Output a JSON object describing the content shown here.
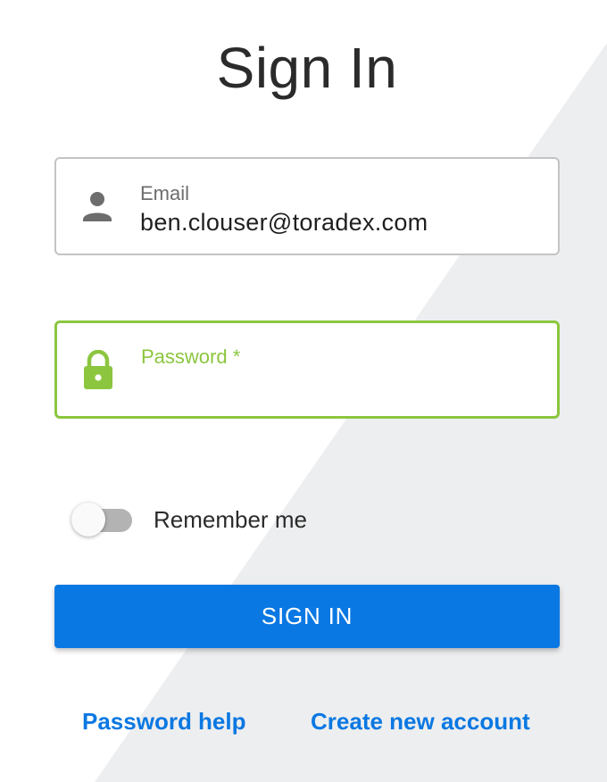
{
  "page": {
    "title": "Sign In"
  },
  "email_field": {
    "label": "Email",
    "value": "ben.clouser@toradex.com",
    "icon": "person-icon"
  },
  "password_field": {
    "label": "Password *",
    "value": "",
    "icon": "lock-icon"
  },
  "remember": {
    "label": "Remember me",
    "checked": false
  },
  "actions": {
    "sign_in_label": "SIGN IN",
    "password_help_label": "Password help",
    "create_account_label": "Create new account"
  },
  "colors": {
    "primary": "#0a78e2",
    "focus_accent": "#8cc63f",
    "background_diagonal": "#edeef0"
  }
}
